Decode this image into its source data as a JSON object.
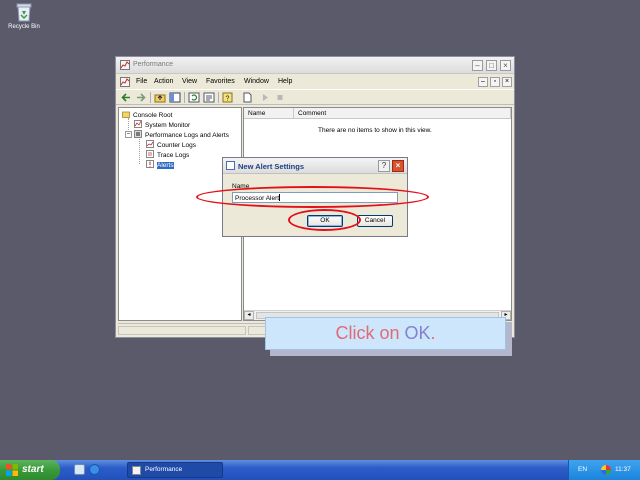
{
  "desktop": {
    "recycle_bin_label": "Recycle Bin"
  },
  "window": {
    "title": "Performance",
    "menu": [
      "File",
      "Action",
      "View",
      "Favorites",
      "Window",
      "Help"
    ],
    "tree": {
      "root": "Console Root",
      "system_monitor": "System Monitor",
      "perf_logs": "Performance Logs and Alerts",
      "counter_logs": "Counter Logs",
      "trace_logs": "Trace Logs",
      "alerts": "Alerts"
    },
    "columns": [
      "Name",
      "Comment"
    ],
    "empty_message": "There are no items to show in this view."
  },
  "dialog": {
    "title": "New Alert Settings",
    "name_label": "Name",
    "name_value": "Processor Alert",
    "ok_label": "OK",
    "cancel_label": "Cancel",
    "help_glyph": "?",
    "close_glyph": "×"
  },
  "callout": {
    "prefix": "Click on ",
    "target": "OK",
    "suffix": "."
  },
  "taskbar": {
    "start_label": "start",
    "task_label": "Performance",
    "language": "EN",
    "clock": "11:37"
  },
  "colors": {
    "highlight_ring": "#e3101a",
    "selection": "#316ac5",
    "taskbar": "#2a5cc8"
  }
}
